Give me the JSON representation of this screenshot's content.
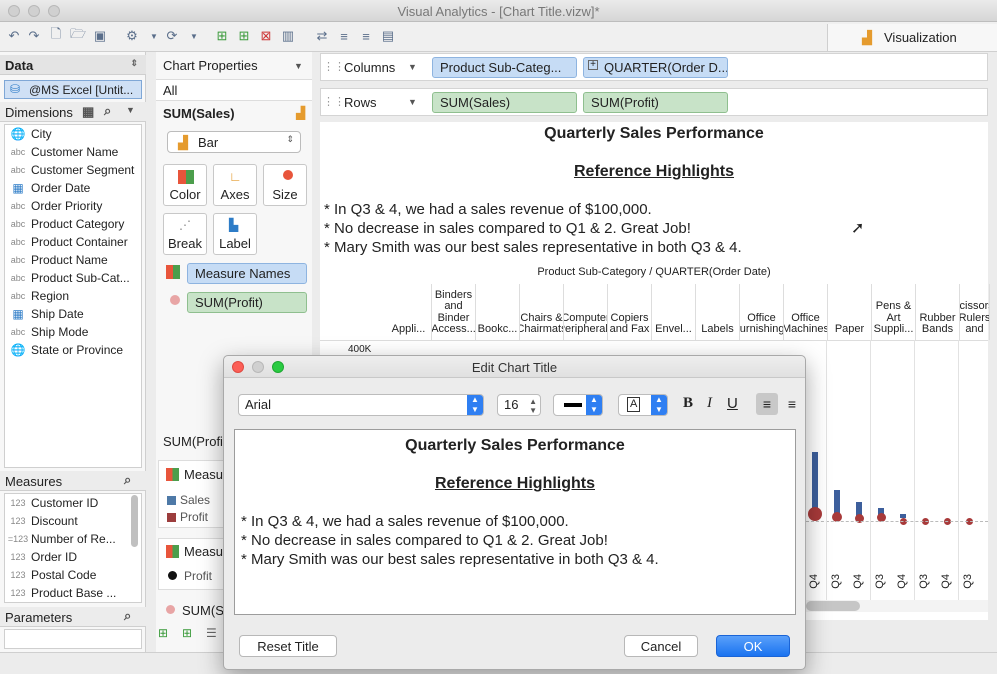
{
  "window": {
    "title": "Visual Analytics - [Chart Title.vizw]*"
  },
  "viz_tab": {
    "label": "Visualization"
  },
  "data_pane": {
    "header": "Data",
    "datasource": "@MS Excel [Untit...",
    "dimensions_header": "Dimensions",
    "dimensions": [
      {
        "type": "globe",
        "label": "City"
      },
      {
        "type": "abc",
        "label": "Customer Name"
      },
      {
        "type": "abc",
        "label": "Customer Segment"
      },
      {
        "type": "date",
        "label": "Order Date"
      },
      {
        "type": "abc",
        "label": "Order Priority"
      },
      {
        "type": "abc",
        "label": "Product Category"
      },
      {
        "type": "abc",
        "label": "Product Container"
      },
      {
        "type": "abc",
        "label": "Product Name"
      },
      {
        "type": "abc",
        "label": "Product Sub-Cat..."
      },
      {
        "type": "abc",
        "label": "Region"
      },
      {
        "type": "date",
        "label": "Ship Date"
      },
      {
        "type": "abc",
        "label": "Ship Mode"
      },
      {
        "type": "globe",
        "label": "State or Province"
      }
    ],
    "measures_header": "Measures",
    "measures": [
      {
        "type": "123",
        "label": "Customer ID"
      },
      {
        "type": "123",
        "label": "Discount"
      },
      {
        "type": "=123",
        "label": "Number of Re..."
      },
      {
        "type": "123",
        "label": "Order ID"
      },
      {
        "type": "123",
        "label": "Postal Code"
      },
      {
        "type": "123",
        "label": "Product Base ..."
      }
    ],
    "parameters_header": "Parameters"
  },
  "props_pane": {
    "header": "Chart Properties",
    "all": "All",
    "measure": "SUM(Sales)",
    "mark_type": "Bar",
    "buttons": {
      "color": "Color",
      "axes": "Axes",
      "size": "Size",
      "break": "Break",
      "label": "Label"
    },
    "measure_names_pill": "Measure Names",
    "profit_pill": "SUM(Profit)",
    "lower_sum": "SUM(Profi",
    "legend_header": "Measu",
    "legend": [
      {
        "label": "Sales",
        "color": "#4e79a7"
      },
      {
        "label": "Profit",
        "color": "#9c3d3d"
      }
    ],
    "legend2_header": "Measu",
    "legend2_item": "Profit",
    "lower_sum2": "SUM(Sa"
  },
  "shelves": {
    "columns_label": "Columns",
    "rows_label": "Rows",
    "columns": [
      "Product Sub-Categ...",
      "QUARTER(Order D..."
    ],
    "rows": [
      "SUM(Sales)",
      "SUM(Profit)"
    ]
  },
  "chart_title": {
    "line1": "Quarterly Sales Performance",
    "line2": "Reference Highlights",
    "bullets": [
      "* In Q3 & 4, we had a sales revenue of $100,000.",
      "* No decrease in sales compared to Q1 & 2. Great Job!",
      "* Mary Smith was our best sales representative in both Q3 & 4."
    ]
  },
  "chart": {
    "header": "Product Sub-Category / QUARTER(Order Date)",
    "columns": [
      "Appli...",
      "Binders and Binder Access...",
      "Bookc...",
      "Chairs & Chairmats",
      "Computer Peripherals",
      "Copiers and Fax",
      "Envel...",
      "Labels",
      "Office Furnishings",
      "Office Machines",
      "Paper",
      "Pens & Art Suppli...",
      "Rubber Bands",
      "Scissors, Rulers and"
    ],
    "y_tick": "400K",
    "quarters": [
      "Q4",
      "Q3",
      "Q4",
      "Q3",
      "Q4",
      "Q3",
      "Q4",
      "Q3"
    ],
    "sales_color": "#3d5f9c",
    "profit_color": "#a83a3a"
  },
  "dialog": {
    "title": "Edit Chart Title",
    "font": "Arial",
    "size": "16",
    "reset": "Reset Title",
    "cancel": "Cancel",
    "ok": "OK"
  }
}
